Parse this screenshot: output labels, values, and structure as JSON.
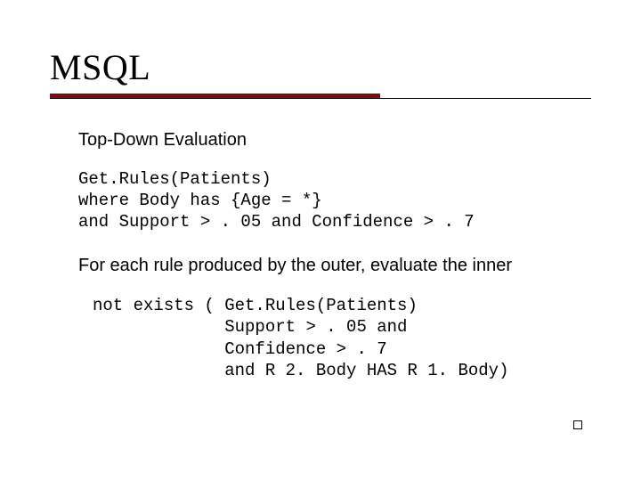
{
  "title": "MSQL",
  "subtitle": "Top-Down Evaluation",
  "code1_line1": "Get.Rules(Patients)",
  "code1_line2": "where Body has {Age = *}",
  "code1_line3": "and Support > . 05 and Confidence > . 7",
  "explain": "For each rule produced by the outer, evaluate the inner",
  "code2_line1": "not exists ( Get.Rules(Patients)",
  "code2_line2": "             Support > . 05 and",
  "code2_line3": "             Confidence > . 7",
  "code2_line4": "             and R 2. Body HAS R 1. Body)"
}
